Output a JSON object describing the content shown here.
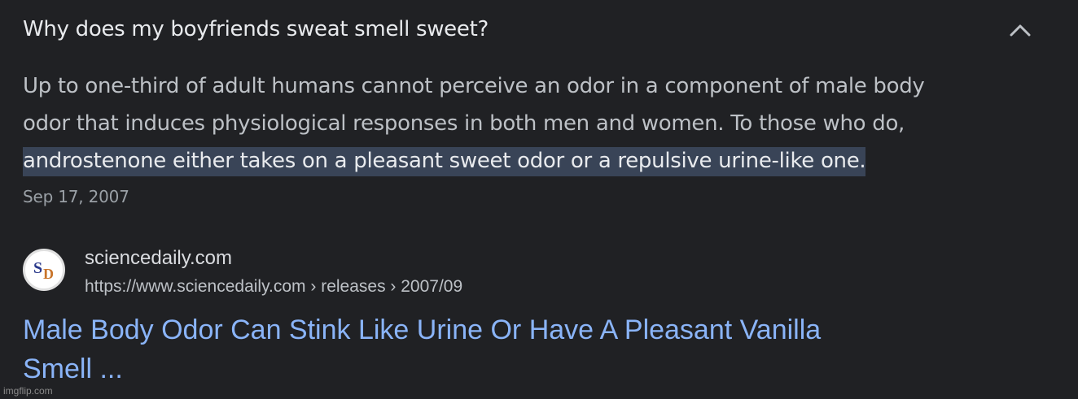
{
  "question": {
    "text": "Why does my boyfriends sweat smell sweet?",
    "collapse_icon": "chevron-up-icon"
  },
  "snippet": {
    "line1": "Up to one-third of adult humans cannot perceive an odor in a component of male body",
    "line2": "odor that induces physiological responses in both men and women. To those who do,",
    "line3_highlighted": "androstenone either takes on a pleasant sweet odor or a repulsive urine-like one."
  },
  "date": "Sep 17, 2007",
  "source": {
    "favicon_letters": [
      "S",
      "D"
    ],
    "favicon_colors": [
      "#2b3a8c",
      "#c8742a"
    ],
    "site_name": "sciencedaily.com",
    "url": "https://www.sciencedaily.com › releases › 2007/09"
  },
  "result": {
    "title_line1": "Male Body Odor Can Stink Like Urine Or Have A Pleasant Vanilla",
    "title_line2": "Smell ..."
  },
  "watermark": "imgflip.com",
  "colors": {
    "background": "#202124",
    "highlight": "#394457",
    "link": "#8ab4f8"
  }
}
